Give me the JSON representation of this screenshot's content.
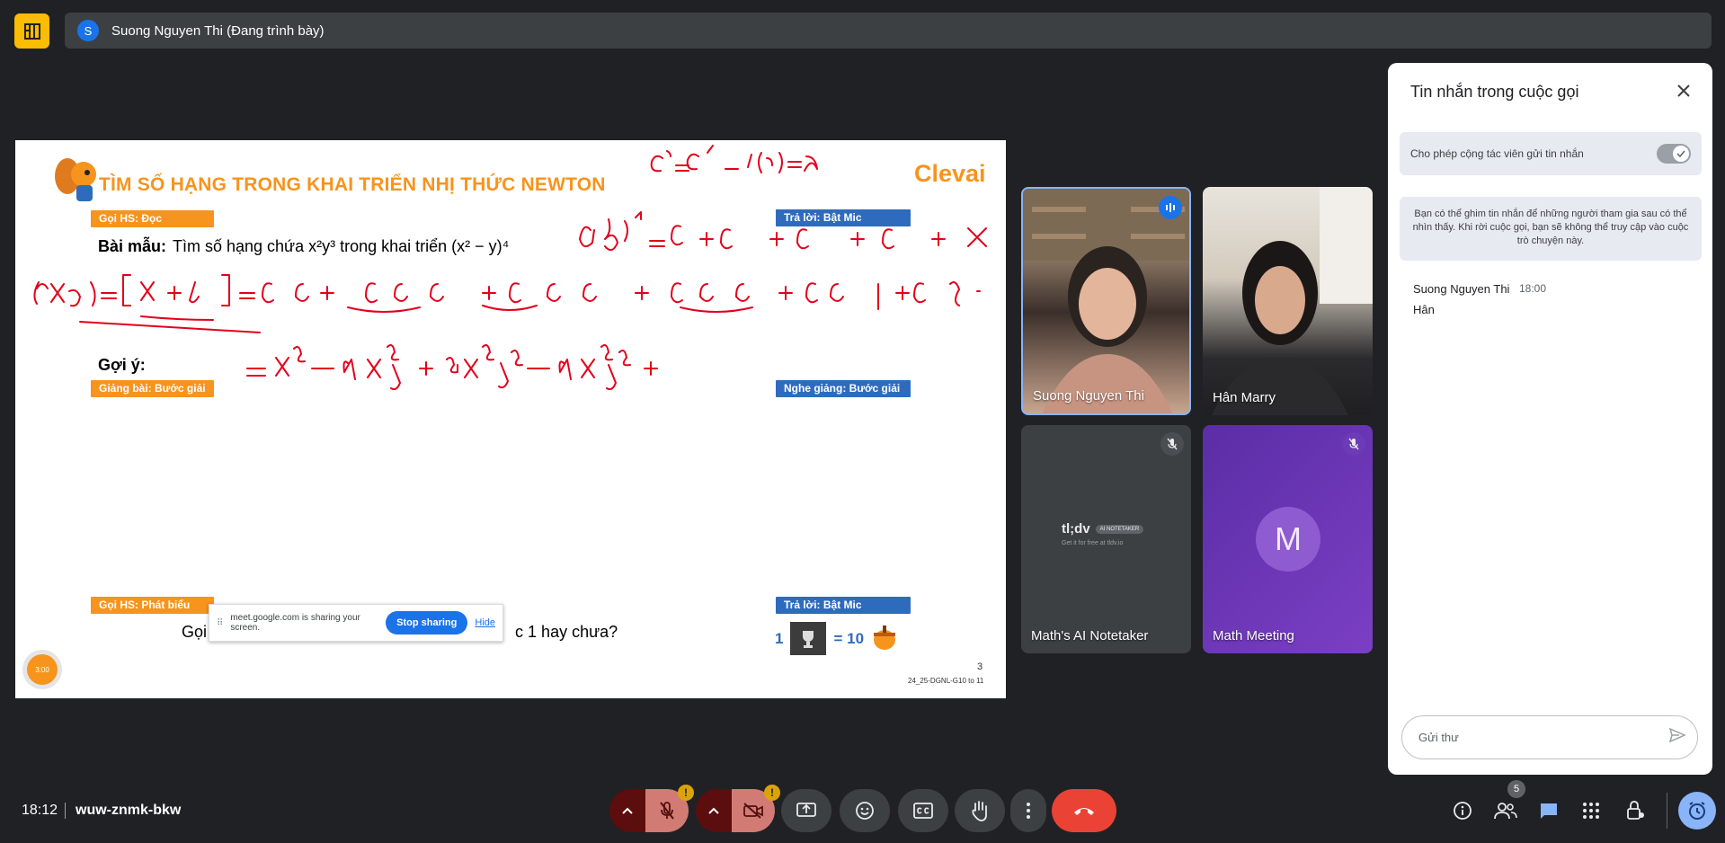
{
  "presenter": {
    "initial": "S",
    "label": "Suong Nguyen Thi (Đang trình bày)"
  },
  "slide": {
    "title": "TÌM SỐ HẠNG TRONG KHAI TRIỂN NHỊ THỨC NEWTON",
    "brand": "Clevai",
    "tags": {
      "goi_hs_doc": "Gọi HS: Đọc",
      "tra_loi_1": "Trả lời: Bật Mic",
      "giang_bai": "Giảng bài: Bước giải",
      "nghe_giang": "Nghe giảng: Bước giải",
      "goi_hs_phat_bieu": "Gọi HS: Phát biểu",
      "tra_loi_2": "Trả lời: Bật Mic"
    },
    "bai_mau_label": "Bài mẫu:",
    "bai_mau_text": "Tìm số hạng chứa x²y³ trong khai triển (x² − y)⁴",
    "goi_y_label": "Gợi ý:",
    "question_start": "Gọi",
    "question_end": "c 1 hay chưa?",
    "score_left": "1",
    "score_right": "= 10",
    "page_number": "3",
    "slide_code": "24_25-DGNL-G10 to 11",
    "timer": "3:00"
  },
  "screen_share": {
    "text": "meet.google.com is sharing your screen.",
    "stop_label": "Stop sharing",
    "hide_label": "Hide"
  },
  "participants": [
    {
      "name": "Suong Nguyen Thi"
    },
    {
      "name": "Hân Marry"
    },
    {
      "name": "Math's AI Notetaker",
      "logo": "tl;dv",
      "logo_badge": "AI NOTETAKER",
      "logo_sub": "Get it for free at tldv.io"
    },
    {
      "name": "Math Meeting",
      "initial": "M"
    }
  ],
  "chat": {
    "title": "Tin nhắn trong cuộc gọi",
    "toggle_label": "Cho phép cộng tác viên gửi tin nhắn",
    "note": "Bạn có thể ghim tin nhắn để những người tham gia sau có thể nhìn thấy. Khi rời cuộc gọi, bạn sẽ không thể truy cập vào cuộc trò chuyện này.",
    "message": {
      "sender": "Suong Nguyen Thi",
      "time": "18:00",
      "text": "Hân"
    },
    "input_placeholder": "Gửi thư"
  },
  "bottom": {
    "time": "18:12",
    "meeting_code": "wuw-znmk-bkw",
    "people_count": "5",
    "warning": "!"
  },
  "colors": {
    "accent": "#f7941d",
    "tag_blue": "#2f6bbd",
    "ink": "#e3001b",
    "leave": "#ea4335"
  }
}
